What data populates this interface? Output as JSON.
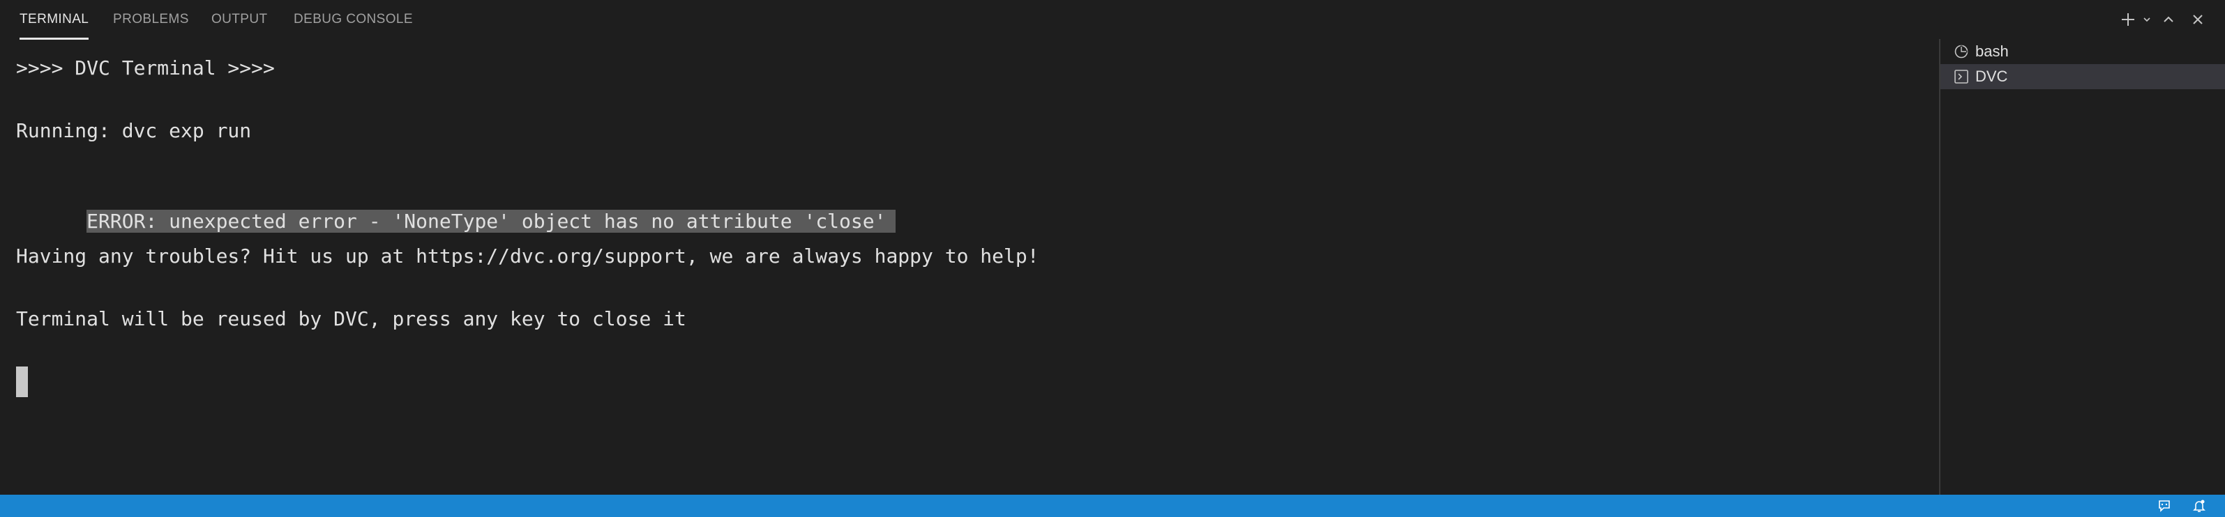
{
  "panel": {
    "tabs": [
      {
        "label": "TERMINAL",
        "active": true
      },
      {
        "label": "PROBLEMS",
        "active": false
      },
      {
        "label": "OUTPUT",
        "active": false
      },
      {
        "label": "DEBUG CONSOLE",
        "active": false
      }
    ],
    "actions": [
      "plus-icon",
      "chevron-down-icon",
      "chevron-up-icon",
      "close-icon"
    ]
  },
  "terminal": {
    "lines": [
      ">>>> DVC Terminal >>>>",
      "Running: dvc exp run",
      "ERROR: unexpected error - 'NoneType' object has no attribute 'close'",
      "Having any troubles? Hit us up at https://dvc.org/support, we are always happy to help!",
      "Terminal will be reused by DVC, press any key to close it"
    ],
    "highlighted_line_index": 2
  },
  "terminal_list": {
    "items": [
      {
        "label": "bash",
        "icon": "bash-terminal-icon",
        "selected": false
      },
      {
        "label": "DVC",
        "icon": "terminal-icon",
        "selected": true
      }
    ]
  },
  "statusbar": {
    "background": "#1a85d0",
    "icons": [
      "feedback-icon",
      "notifications-bell-icon"
    ]
  },
  "colors": {
    "background": "#1e1e1e",
    "highlight": "#5a5a5a",
    "selected_item": "#37373d"
  }
}
